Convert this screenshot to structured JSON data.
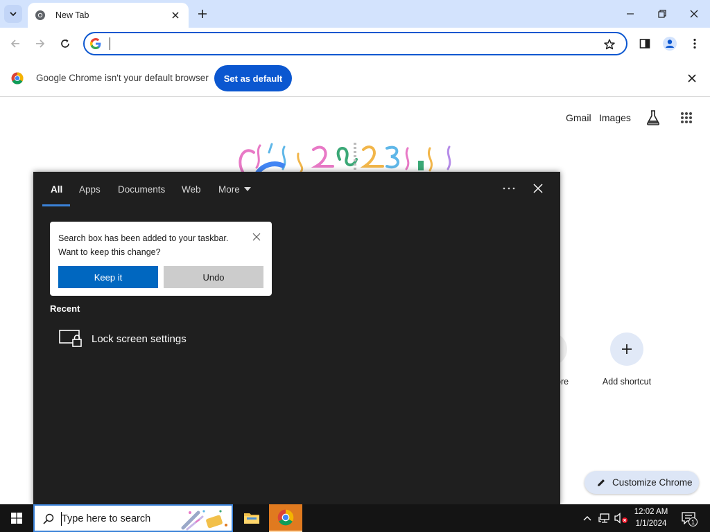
{
  "browser": {
    "tab": {
      "title": "New Tab"
    },
    "omnibox": {
      "value": "",
      "placeholder": ""
    },
    "infobar": {
      "message": "Google Chrome isn't your default browser",
      "button_label": "Set as default"
    }
  },
  "ntp": {
    "links": [
      "Gmail",
      "Images"
    ],
    "shortcut_partial_label": "ore",
    "add_shortcut_label": "Add shortcut",
    "customize_label": "Customize Chrome"
  },
  "search_flyout": {
    "tabs": [
      "All",
      "Apps",
      "Documents",
      "Web",
      "More"
    ],
    "active_tab": "All",
    "tip": {
      "line1": "Search box has been added to your taskbar.",
      "line2": "Want to keep this change?",
      "keep_label": "Keep it",
      "undo_label": "Undo"
    },
    "recent_heading": "Recent",
    "recent_items": [
      "Lock screen settings"
    ]
  },
  "taskbar": {
    "search_placeholder": "Type here to search",
    "time": "12:02 AM",
    "date": "1/1/2024",
    "notification_count": "1"
  },
  "colors": {
    "tabstrip": "#d3e3fd",
    "accent_blue": "#0b57d0",
    "flyout_bg": "#1f1f1f",
    "keep_button": "#0067c0",
    "chrome_taskbar_active": "#e07a1f"
  }
}
